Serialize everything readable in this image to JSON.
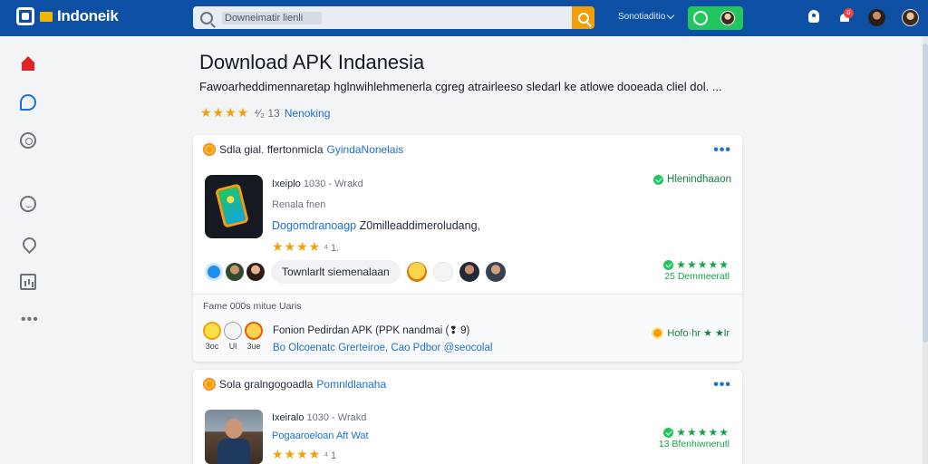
{
  "header": {
    "brand": "Indoneik",
    "search_value": "Downeimatir lienli",
    "lang_label": "Sonotiaditio",
    "notification_count": "0",
    "icons": [
      "logo-icon",
      "flag-icon",
      "search-icon",
      "chevron-down-icon",
      "whatsapp-icon",
      "rocket-icon",
      "bell-icon"
    ]
  },
  "sidebar": {
    "items": [
      "home-icon",
      "chat-icon",
      "target-icon",
      "smile-icon",
      "pin-icon",
      "chart-icon",
      "more-icon"
    ],
    "more_label": "•••"
  },
  "page": {
    "title": "Download APK Indanesia",
    "description": "Fawoarheddimennaretap hglnwihlehmenerla cgreg atrairleeso sledarl ke atlowe dooeada cliel dol. ...",
    "stars": "★★★★",
    "rating_count": "⁴⁄₂ 13",
    "rating_link": "Nenoking"
  },
  "card1": {
    "category_prefix": "Sdla gial. ffertonmicla",
    "category_link": "GyindaNonelais",
    "more": "•••",
    "app_name": "Ixeiplo",
    "app_meta": "1030 - Wrakd",
    "app_line2": "Renala fnen",
    "app_desc_link": "Dogomdranoagp",
    "app_desc_rest": "Z0milleaddimeroludang,",
    "stars": "★★★★",
    "star_count": "⁴ 1.",
    "status": "Hlenindhaaon",
    "pill_label": "Townlarlt siemenalaan",
    "rating_stars": "★★★★★",
    "rating_label": "25 Demmeeratl",
    "sub_title": "Fame 000s mitue Uaris",
    "emoji_labels": [
      "3oc",
      "Ul",
      "3ue"
    ],
    "sub_line1": "Fonion Pedirdan APK (PPK nandmai (❢ 9)",
    "sub_line2": "Bo Olcoenatc Grerteiroe, Cao Pdbor @seocolal",
    "sub_status": "Hofo·hr ★ ★lr"
  },
  "card2": {
    "category_prefix": "Sola gralngogoadla",
    "category_link": "Pomnldlanaha",
    "more": "•••",
    "app_name": "Ixeiralo",
    "app_meta": "1030 - Wrakd",
    "app_link": "Pogaaroeloan Aft Wat",
    "stars": "★★★★",
    "star_count": "⁴ 1",
    "rating_stars": "★★★★★",
    "rating_label": "13 Bfenhiwnerutl"
  }
}
